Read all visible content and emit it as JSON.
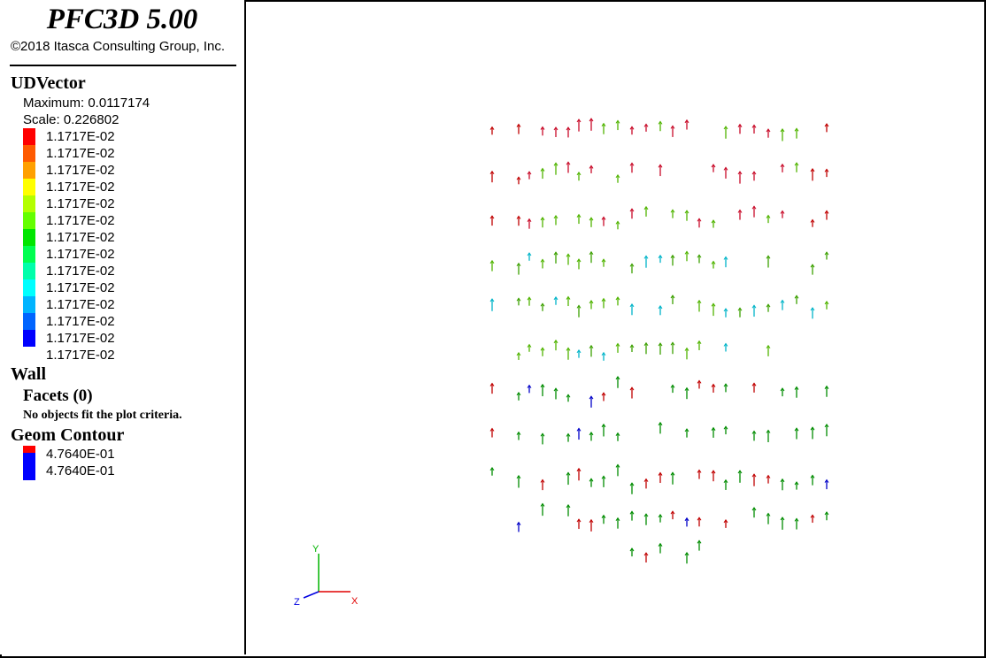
{
  "header": {
    "app_title": "PFC3D 5.00",
    "copyright": "©2018 Itasca Consulting Group, Inc."
  },
  "udvector": {
    "title": "UDVector",
    "maximum": "Maximum: 0.0117174",
    "scale": "Scale: 0.226802",
    "colors": [
      "#ff0000",
      "#ff5a00",
      "#ffa000",
      "#ffff00",
      "#b4ff00",
      "#64ff00",
      "#00e600",
      "#00ff50",
      "#00ffaa",
      "#00ffff",
      "#00b4ff",
      "#0064ff",
      "#0000ff"
    ],
    "labels": [
      "1.1717E-02",
      "1.1717E-02",
      "1.1717E-02",
      "1.1717E-02",
      "1.1717E-02",
      "1.1717E-02",
      "1.1717E-02",
      "1.1717E-02",
      "1.1717E-02",
      "1.1717E-02",
      "1.1717E-02",
      "1.1717E-02",
      "1.1717E-02",
      "1.1717E-02"
    ]
  },
  "wall": {
    "title": "Wall",
    "facets_title": "Facets (0)",
    "note": "No objects fit the plot criteria."
  },
  "geom_contour": {
    "title": "Geom Contour",
    "colors": [
      "#ff0000",
      "#0000ff"
    ],
    "labels": [
      "4.7640E-01",
      "4.7640E-01"
    ]
  },
  "axes": {
    "y": "Y",
    "z": "Z",
    "x": "X"
  },
  "vector_colors": [
    "#c00000",
    "#c80a28",
    "#50b400",
    "#3ca000",
    "#00a050",
    "#00b4c8",
    "#0000c8",
    "#008c00"
  ]
}
